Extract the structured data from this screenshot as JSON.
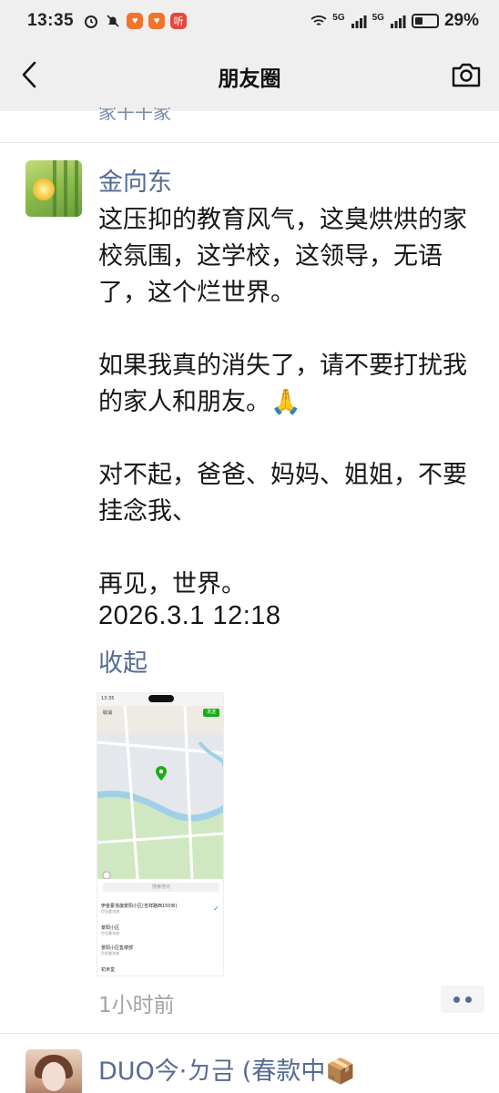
{
  "status_bar": {
    "time": "13:35",
    "network_a": "5G",
    "network_b": "5G",
    "battery": "29%",
    "battery_level": 0.29,
    "app_badge_text": "听"
  },
  "nav": {
    "title": "朋友圈",
    "back_icon": "chevron-left-icon",
    "camera_icon": "camera-icon"
  },
  "previous_post": {
    "cut_text": "家干干家"
  },
  "post": {
    "author": "金向东",
    "body": "这压抑的教育风气，这臭烘烘的家校氛围，这学校，这领导，无语了，这个烂世界。\n\n如果我真的消失了，请不要打扰我的家人和朋友。🙏\n\n对不起，爸爸、妈妈、姐姐，不要挂念我、\n\n再见，世界。",
    "timestamp": "2026.3.1  12:18",
    "collapse_label": "收起",
    "relative_time": "1小时前",
    "more_icon": "more-dots-icon",
    "map_screenshot": {
      "status_time": "13:35",
      "cancel": "取消",
      "send": "发送",
      "search_placeholder": "搜索地点",
      "items": [
        {
          "name": "伊金霍洛旗景阳小区(吉祥路西150米)",
          "sub": "伊金霍洛旗"
        },
        {
          "name": "景阳小区",
          "sub": "伊金霍洛旗"
        },
        {
          "name": "景阳小区售楼部",
          "sub": "伊金霍洛旗"
        },
        {
          "name": "初禾堂",
          "sub": ""
        }
      ]
    }
  },
  "next_post": {
    "author": "DUO今·ㄉ금 (春款中📦"
  },
  "colors": {
    "link": "#566b94",
    "bar_bg": "#efefef",
    "accent_green": "#1aad19"
  }
}
